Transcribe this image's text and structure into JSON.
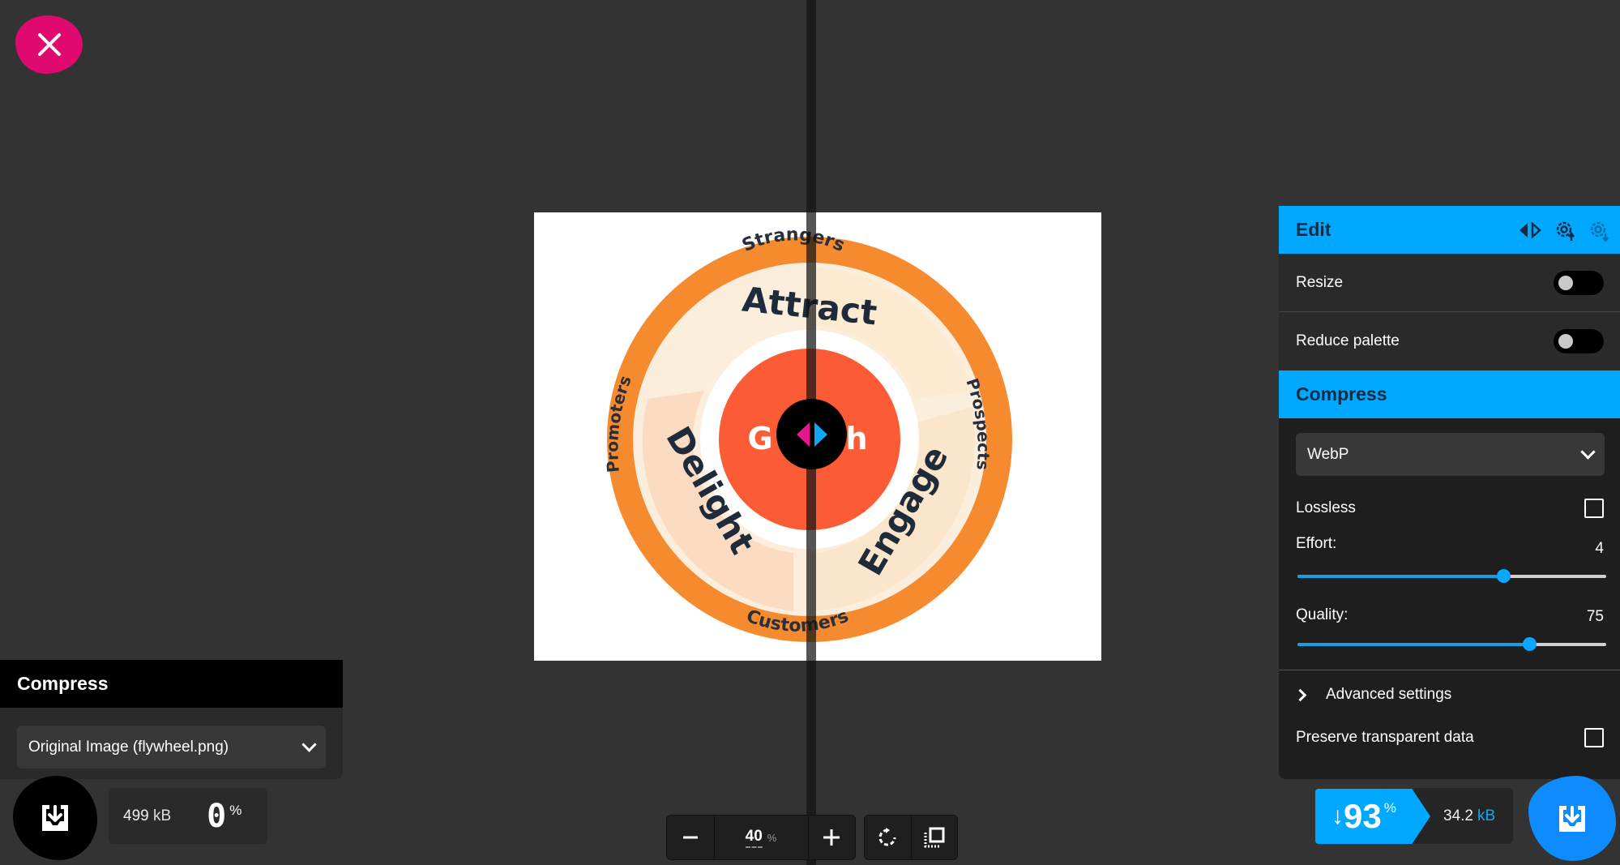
{
  "close_button": {
    "icon": "close-icon"
  },
  "preview": {
    "image_name": "flywheel.png",
    "flywheel": {
      "outer_labels": [
        "Strangers",
        "Prospects",
        "Customers",
        "Promoters"
      ],
      "stages": [
        "Attract",
        "Engage",
        "Delight"
      ],
      "center_left": "G",
      "center_right": "h"
    },
    "divider_icon": "split-compare-handle-icon"
  },
  "left_panel": {
    "title": "Compress",
    "select_value": "Original Image (flywheel.png)",
    "file_size_value": "499",
    "file_size_unit": "kB",
    "reduction_value": "0",
    "reduction_symbol": "%"
  },
  "zoom_controls": {
    "zoom_value": "40",
    "zoom_unit": "%"
  },
  "edit_panel": {
    "title": "Edit",
    "resize_label": "Resize",
    "resize_enabled": false,
    "reduce_palette_label": "Reduce palette",
    "reduce_palette_enabled": false,
    "compress_title": "Compress",
    "format_value": "WebP",
    "lossless_label": "Lossless",
    "lossless_checked": false,
    "effort_label": "Effort:",
    "effort_value": "4",
    "effort_min": 0,
    "effort_max": 6,
    "quality_label": "Quality:",
    "quality_value": "75",
    "quality_min": 0,
    "quality_max": 100,
    "advanced_label": "Advanced settings",
    "preserve_label": "Preserve transparent data",
    "preserve_checked": false
  },
  "result": {
    "arrow": "↓",
    "reduction_value": "93",
    "reduction_symbol": "%",
    "file_size_value": "34.2",
    "file_size_unit": "kB"
  },
  "colors": {
    "accent_blue": "#00a8ff",
    "close_pink": "#e0096f",
    "background": "#333333"
  }
}
